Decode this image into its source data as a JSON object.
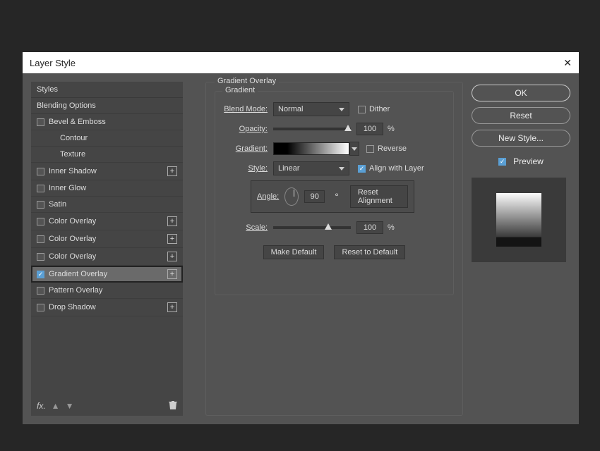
{
  "dialog": {
    "title": "Layer Style",
    "close": "✕"
  },
  "styles": {
    "header1": "Styles",
    "header2": "Blending Options",
    "items": [
      {
        "label": "Bevel & Emboss",
        "checked": false,
        "plus": false,
        "sub": false
      },
      {
        "label": "Contour",
        "checked": false,
        "plus": false,
        "sub": true,
        "nocb": true
      },
      {
        "label": "Texture",
        "checked": false,
        "plus": false,
        "sub": true,
        "nocb": true
      },
      {
        "label": "Inner Shadow",
        "checked": false,
        "plus": true,
        "sub": false
      },
      {
        "label": "Inner Glow",
        "checked": false,
        "plus": false,
        "sub": false
      },
      {
        "label": "Satin",
        "checked": false,
        "plus": false,
        "sub": false
      },
      {
        "label": "Color Overlay",
        "checked": false,
        "plus": true,
        "sub": false
      },
      {
        "label": "Color Overlay",
        "checked": false,
        "plus": true,
        "sub": false
      },
      {
        "label": "Color Overlay",
        "checked": false,
        "plus": true,
        "sub": false
      },
      {
        "label": "Gradient Overlay",
        "checked": true,
        "plus": true,
        "sub": false,
        "selected": true
      },
      {
        "label": "Pattern Overlay",
        "checked": false,
        "plus": false,
        "sub": false
      },
      {
        "label": "Drop Shadow",
        "checked": false,
        "plus": true,
        "sub": false
      }
    ],
    "footer": {
      "fx": "fx.",
      "up": "⬆",
      "down": "⬇",
      "trash": "🗑"
    }
  },
  "settings": {
    "group_title": "Gradient Overlay",
    "inner_title": "Gradient",
    "blend_mode": {
      "label": "Blend Mode:",
      "value": "Normal"
    },
    "dither": {
      "label": "Dither",
      "checked": false
    },
    "opacity": {
      "label": "Opacity:",
      "value": "100",
      "unit": "%"
    },
    "gradient": {
      "label": "Gradient:"
    },
    "reverse": {
      "label": "Reverse",
      "checked": false
    },
    "style": {
      "label": "Style:",
      "value": "Linear"
    },
    "align": {
      "label": "Align with Layer",
      "checked": true
    },
    "angle": {
      "label": "Angle:",
      "value": "90",
      "unit": "°",
      "reset": "Reset Alignment"
    },
    "scale": {
      "label": "Scale:",
      "value": "100",
      "unit": "%"
    },
    "make_default": "Make Default",
    "reset_default": "Reset to Default"
  },
  "actions": {
    "ok": "OK",
    "reset": "Reset",
    "new_style": "New Style...",
    "preview": "Preview",
    "preview_checked": true
  }
}
